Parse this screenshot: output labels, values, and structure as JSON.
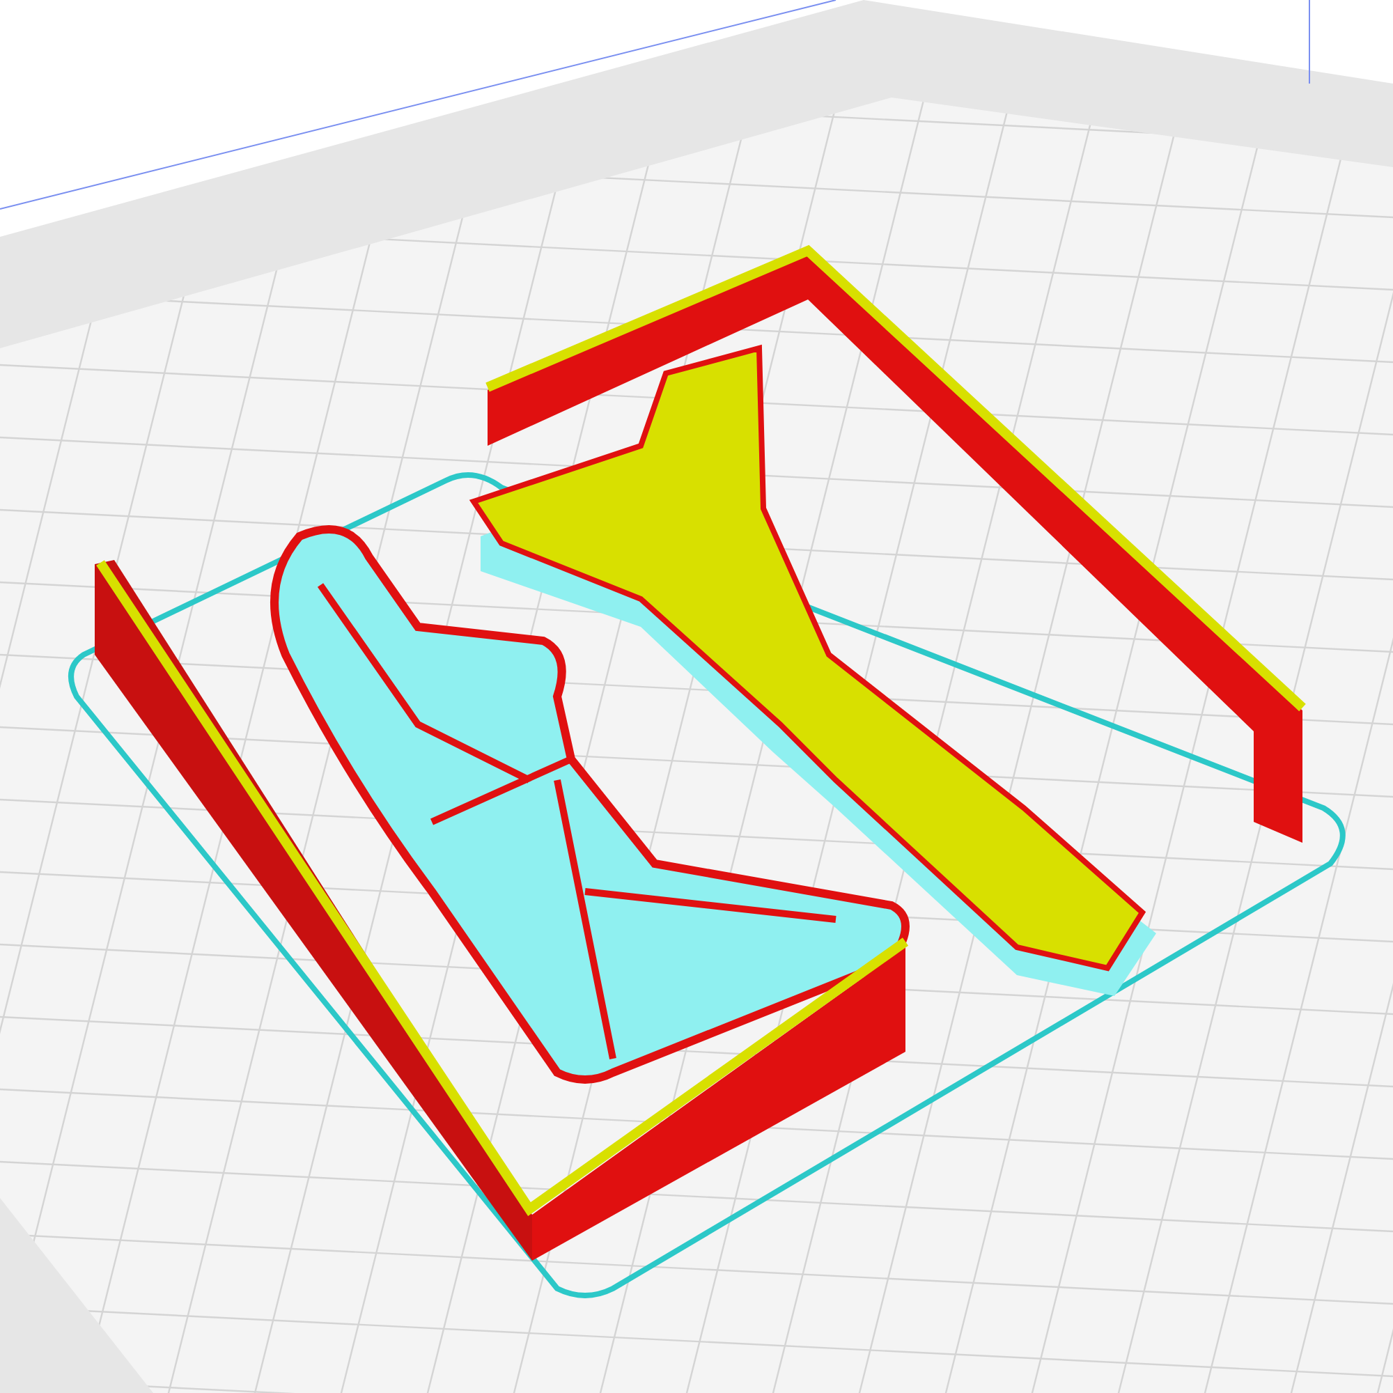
{
  "viewport": {
    "show_grid": true,
    "show_skirt": true
  }
}
